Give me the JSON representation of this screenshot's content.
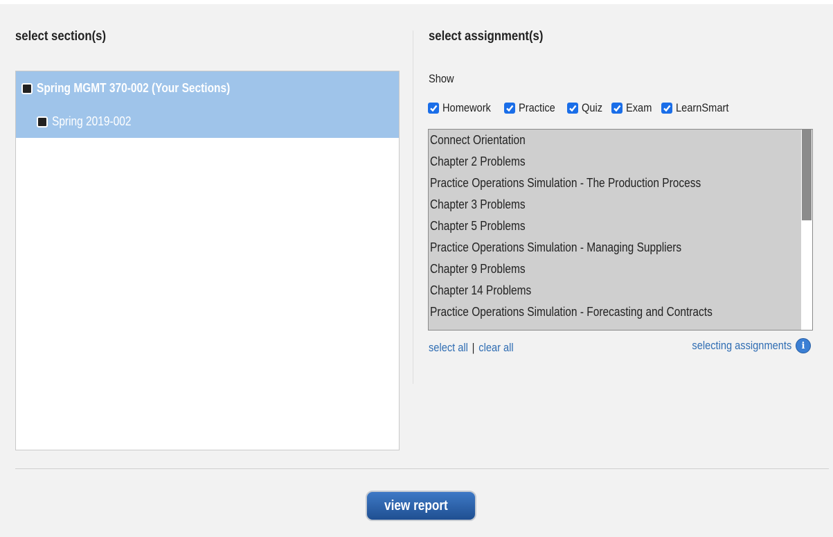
{
  "sections": {
    "heading": "select section(s)",
    "tree": [
      {
        "label": "Spring MGMT 370-002 (Your Sections)",
        "bold": true,
        "level": 0
      },
      {
        "label": "Spring 2019-002",
        "bold": false,
        "level": 1
      }
    ]
  },
  "assignments": {
    "heading": "select assignment(s)",
    "show_label": "Show",
    "filters": [
      {
        "label": "Homework",
        "checked": true
      },
      {
        "label": "Practice",
        "checked": true
      },
      {
        "label": "Quiz",
        "checked": true
      },
      {
        "label": "Exam",
        "checked": true
      },
      {
        "label": "LearnSmart",
        "checked": true
      }
    ],
    "items": [
      "Connect Orientation",
      "Chapter 2 Problems",
      "Practice Operations Simulation - The Production Process",
      "Chapter 3 Problems",
      "Chapter 5 Problems",
      "Practice Operations Simulation - Managing Suppliers",
      "Chapter 9 Problems",
      "Chapter 14 Problems",
      "Practice Operations Simulation - Forecasting and Contracts"
    ],
    "select_all": "select all",
    "separator": "|",
    "clear_all": "clear all",
    "help_link": "selecting assignments",
    "info_icon": "i"
  },
  "actions": {
    "view_report": "view report"
  },
  "colors": {
    "selected_row": "#9fc4ea",
    "link": "#2f6db3",
    "checkbox": "#1a6ee8",
    "button": "#1f4f91"
  }
}
